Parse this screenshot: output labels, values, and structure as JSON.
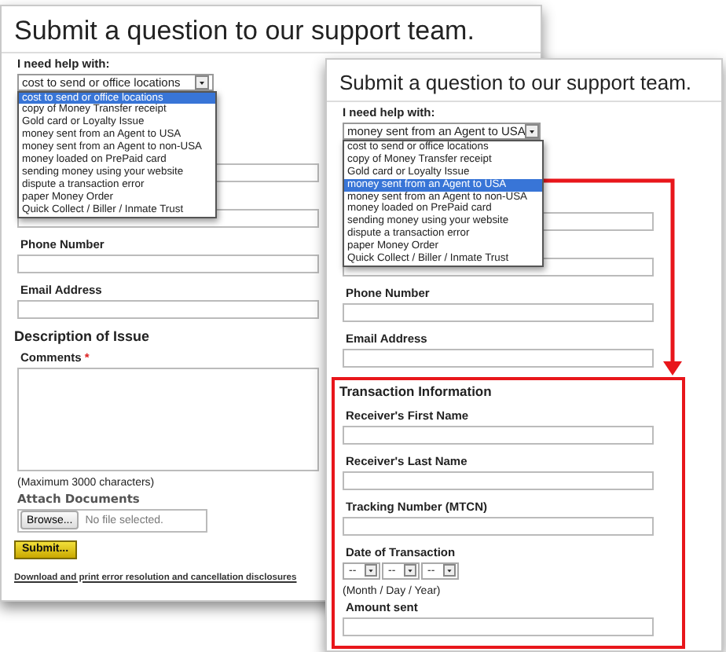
{
  "panels": [
    {
      "title": "Submit a question to our support team.",
      "help": {
        "label": "I need help with:",
        "value": "cost to send or office locations",
        "expanded": true,
        "options": [
          {
            "label": "cost to send or office locations",
            "selected": true
          },
          {
            "label": "copy of Money Transfer receipt",
            "selected": false
          },
          {
            "label": "Gold card or Loyalty Issue",
            "selected": false
          },
          {
            "label": "money sent from an Agent to USA",
            "selected": false
          },
          {
            "label": "money sent from an Agent to non-USA",
            "selected": false
          },
          {
            "label": "money loaded on PrePaid card",
            "selected": false
          },
          {
            "label": "sending money using your website",
            "selected": false
          },
          {
            "label": "dispute a transaction error",
            "selected": false
          },
          {
            "label": "paper Money Order",
            "selected": false
          },
          {
            "label": "Quick Collect / Biller / Inmate Trust",
            "selected": false
          }
        ]
      },
      "fields": [
        {
          "kind": "text"
        },
        {
          "kind": "text"
        },
        {
          "kind": "text",
          "label": "Phone Number"
        },
        {
          "kind": "text",
          "label": "Email Address"
        },
        {
          "kind": "heading",
          "label": "Description of Issue"
        },
        {
          "kind": "textarea",
          "label": "Comments",
          "required_mark": "*"
        },
        {
          "kind": "note",
          "label": "(Maximum 3000 characters)"
        },
        {
          "kind": "file",
          "label": "Attach Documents",
          "button": "Browse...",
          "status": "No file selected."
        }
      ],
      "submit": "Submit...",
      "link": "Download and print error resolution and cancellation disclosures"
    },
    {
      "title": "Submit a question to our support team.",
      "help": {
        "label": "I need help with:",
        "value": "money sent from an Agent to USA",
        "expanded": true,
        "options": [
          {
            "label": "cost to send or office locations",
            "selected": false
          },
          {
            "label": "copy of Money Transfer receipt",
            "selected": false
          },
          {
            "label": "Gold card or Loyalty Issue",
            "selected": false
          },
          {
            "label": "money sent from an Agent to USA",
            "selected": true
          },
          {
            "label": "money sent from an Agent to non-USA",
            "selected": false
          },
          {
            "label": "money loaded on PrePaid card",
            "selected": false
          },
          {
            "label": "sending money using your website",
            "selected": false
          },
          {
            "label": "dispute a transaction error",
            "selected": false
          },
          {
            "label": "paper Money Order",
            "selected": false
          },
          {
            "label": "Quick Collect / Biller / Inmate Trust",
            "selected": false
          }
        ]
      },
      "fields": [
        {
          "kind": "text"
        },
        {
          "kind": "text"
        },
        {
          "kind": "text",
          "label": "Phone Number"
        },
        {
          "kind": "text",
          "label": "Email Address"
        },
        {
          "kind": "section",
          "label": "Transaction Information",
          "highlighted": true,
          "fields": [
            {
              "kind": "text",
              "label": "Receiver's First Name"
            },
            {
              "kind": "text",
              "label": "Receiver's Last Name"
            },
            {
              "kind": "text",
              "label": "Tracking Number (MTCN)"
            },
            {
              "kind": "date",
              "label": "Date of Transaction",
              "parts": [
                "--",
                "--",
                "--"
              ]
            },
            {
              "kind": "note",
              "label": "(Month / Day / Year)"
            },
            {
              "kind": "text",
              "label": "Amount sent"
            }
          ]
        }
      ]
    }
  ]
}
